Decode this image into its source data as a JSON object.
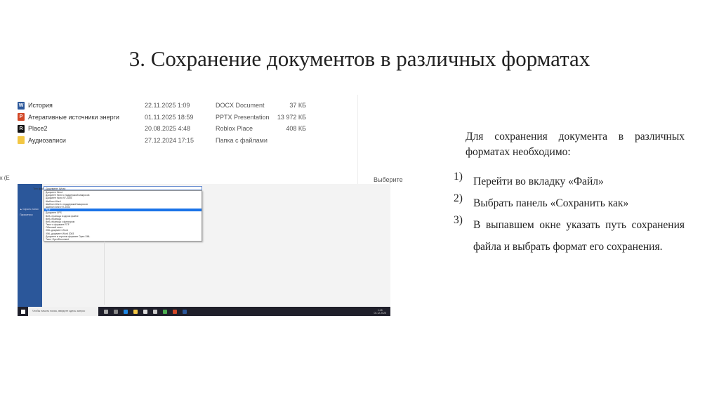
{
  "slide": {
    "title": "3. Сохранение документов в различных форматах"
  },
  "files": [
    {
      "name": "История",
      "date": "22.11.2025 1:09",
      "type": "DOCX Document",
      "size": "37 КБ",
      "icon": "word-icon",
      "color": "#2b579a",
      "glyph": "W"
    },
    {
      "name": "Атеративные источники энерги",
      "date": "01.11.2025 18:59",
      "type": "PPTX Presentation",
      "size": "13 972 КБ",
      "icon": "powerpoint-icon",
      "color": "#d24726",
      "glyph": "P"
    },
    {
      "name": "Place2",
      "date": "20.08.2025 4:48",
      "type": "Roblox Place",
      "size": "408 КБ",
      "icon": "roblox-icon",
      "color": "#111",
      "glyph": "R"
    },
    {
      "name": "Аудиозаписи",
      "date": "27.12.2024 17:15",
      "type": "Папка с файлами",
      "size": "",
      "icon": "folder-icon",
      "color": "#f3c744",
      "glyph": ""
    }
  ],
  "fragments": {
    "left": "к (E",
    "right": "Выберите"
  },
  "dialog": {
    "file_type_label": "Тип файла:",
    "file_type_value": "Документ Word",
    "hide_folders": "▲ Скрыть папки",
    "params": "Параметры",
    "options": [
      "Документ Word",
      "Документ Word с поддержкой макросов",
      "Документ Word 97-2003",
      "Шаблон Word",
      "Шаблон Word с поддержкой макросов",
      "Шаблон Word 97-2003",
      "PDF",
      "Документ XPS",
      "Веб-страница в одном файле",
      "Веб-страница",
      "Веб-страница с фильтром",
      "Текст в формате RTF",
      "Обычный текст",
      "XML-документ Word",
      "XML-документ Word 2003",
      "Документ в строгом формате Open XML",
      "Текст OpenDocument"
    ],
    "selected_index": 6
  },
  "taskbar": {
    "search_placeholder": "Чтобы начать поиск, введите здесь запрос",
    "time": "1:45",
    "date": "04.12.2025"
  },
  "body": {
    "intro": "Для сохранения документа в различных форматах необходимо:",
    "steps": [
      {
        "n": "1)",
        "text": "Перейти во вкладку «Файл»"
      },
      {
        "n": "2)",
        "text": "Выбрать панель «Сохранить как»"
      },
      {
        "n": "3)",
        "text": "В выпавшем окне указать путь сохранения файла и выбрать формат его сохранения."
      }
    ]
  }
}
